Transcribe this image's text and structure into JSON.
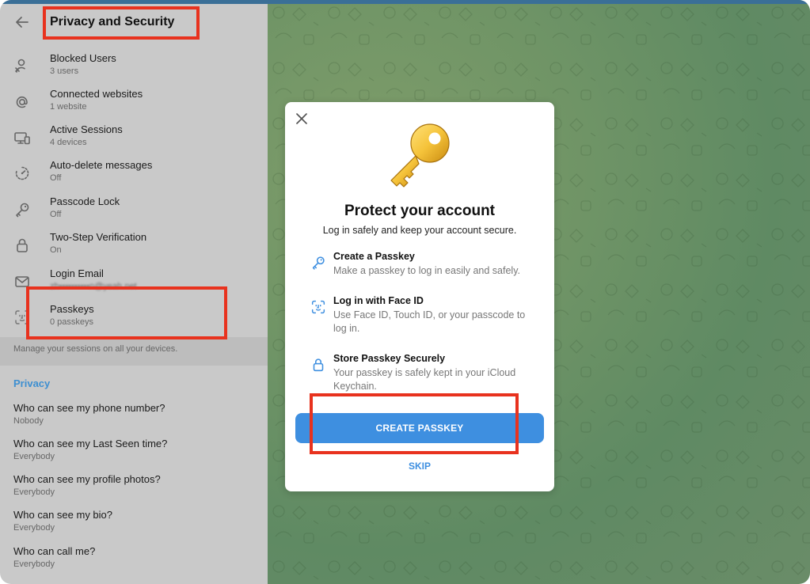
{
  "sidebar": {
    "title": "Privacy and Security",
    "items": [
      {
        "label": "Blocked Users",
        "value": "3 users",
        "icon": "blocked-user-icon"
      },
      {
        "label": "Connected websites",
        "value": "1 website",
        "icon": "at-sign-icon"
      },
      {
        "label": "Active Sessions",
        "value": "4 devices",
        "icon": "devices-icon"
      },
      {
        "label": "Auto-delete messages",
        "value": "Off",
        "icon": "timer-icon"
      },
      {
        "label": "Passcode Lock",
        "value": "Off",
        "icon": "key-icon"
      },
      {
        "label": "Two-Step Verification",
        "value": "On",
        "icon": "lock-icon"
      },
      {
        "label": "Login Email",
        "value": "zh••••••••••n@yeah.net",
        "icon": "mail-icon"
      },
      {
        "label": "Passkeys",
        "value": "0 passkeys",
        "icon": "face-id-icon"
      }
    ],
    "footer_note": "Manage your sessions on all your devices.",
    "privacy_section": {
      "heading": "Privacy",
      "items": [
        {
          "label": "Who can see my phone number?",
          "value": "Nobody"
        },
        {
          "label": "Who can see my Last Seen time?",
          "value": "Everybody"
        },
        {
          "label": "Who can see my profile photos?",
          "value": "Everybody"
        },
        {
          "label": "Who can see my bio?",
          "value": "Everybody"
        },
        {
          "label": "Who can call me?",
          "value": "Everybody"
        }
      ]
    }
  },
  "modal": {
    "title": "Protect your account",
    "subtitle": "Log in safely and keep your account secure.",
    "features": [
      {
        "title": "Create a Passkey",
        "desc": "Make a passkey to log in easily and safely.",
        "icon": "key-icon"
      },
      {
        "title": "Log in with Face ID",
        "desc": "Use Face ID, Touch ID, or your passcode to log in.",
        "icon": "face-id-icon"
      },
      {
        "title": "Store Passkey Securely",
        "desc": "Your passkey is safely kept in your iCloud Keychain.",
        "icon": "lock-icon"
      }
    ],
    "primary_button": "CREATE PASSKEY",
    "secondary_button": "SKIP"
  },
  "colors": {
    "accent": "#3e8fe0",
    "link": "#3d8fd1",
    "highlight": "#e8321e",
    "sidebar_bg": "#c9c9c9",
    "chat_bg": "#6f9466"
  }
}
